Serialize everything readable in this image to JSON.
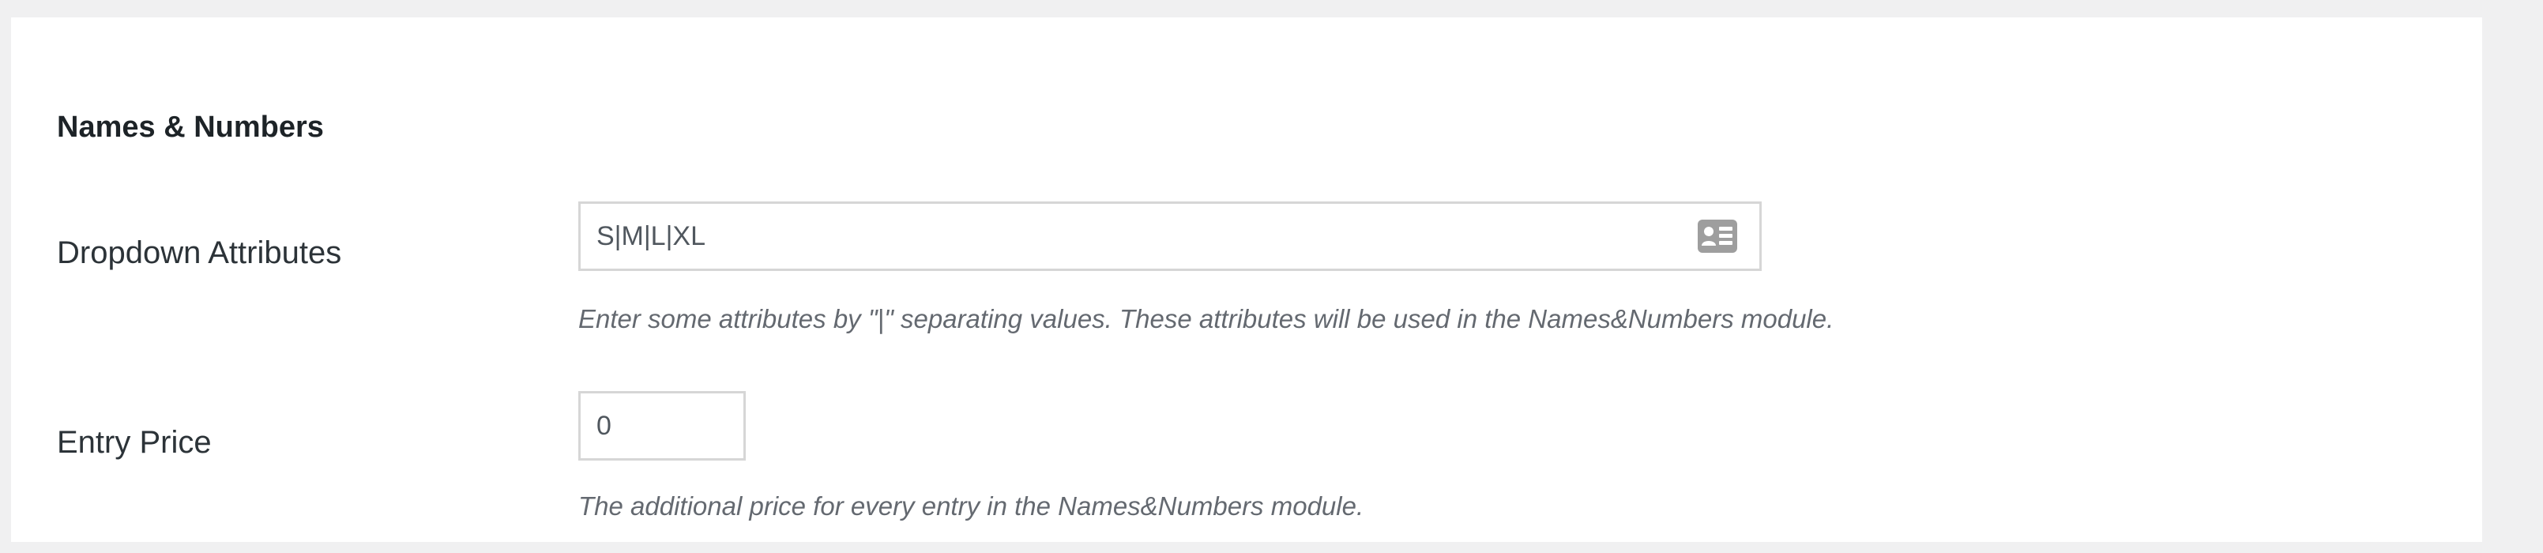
{
  "section": {
    "title": "Names & Numbers"
  },
  "fields": {
    "dropdown_attributes": {
      "label": "Dropdown Attributes",
      "value": "S|M|L|XL",
      "description": "Enter some attributes by \"|\" separating values. These attributes will be used in the Names&Numbers module.",
      "icon": "contact-card-icon"
    },
    "entry_price": {
      "label": "Entry Price",
      "value": "0",
      "description": "The additional price for every entry in the Names&Numbers module."
    }
  },
  "colors": {
    "page_background": "#f0f0f1",
    "panel_background": "#ffffff",
    "input_border": "#d6d6d6",
    "icon": "#9e9e9e"
  }
}
